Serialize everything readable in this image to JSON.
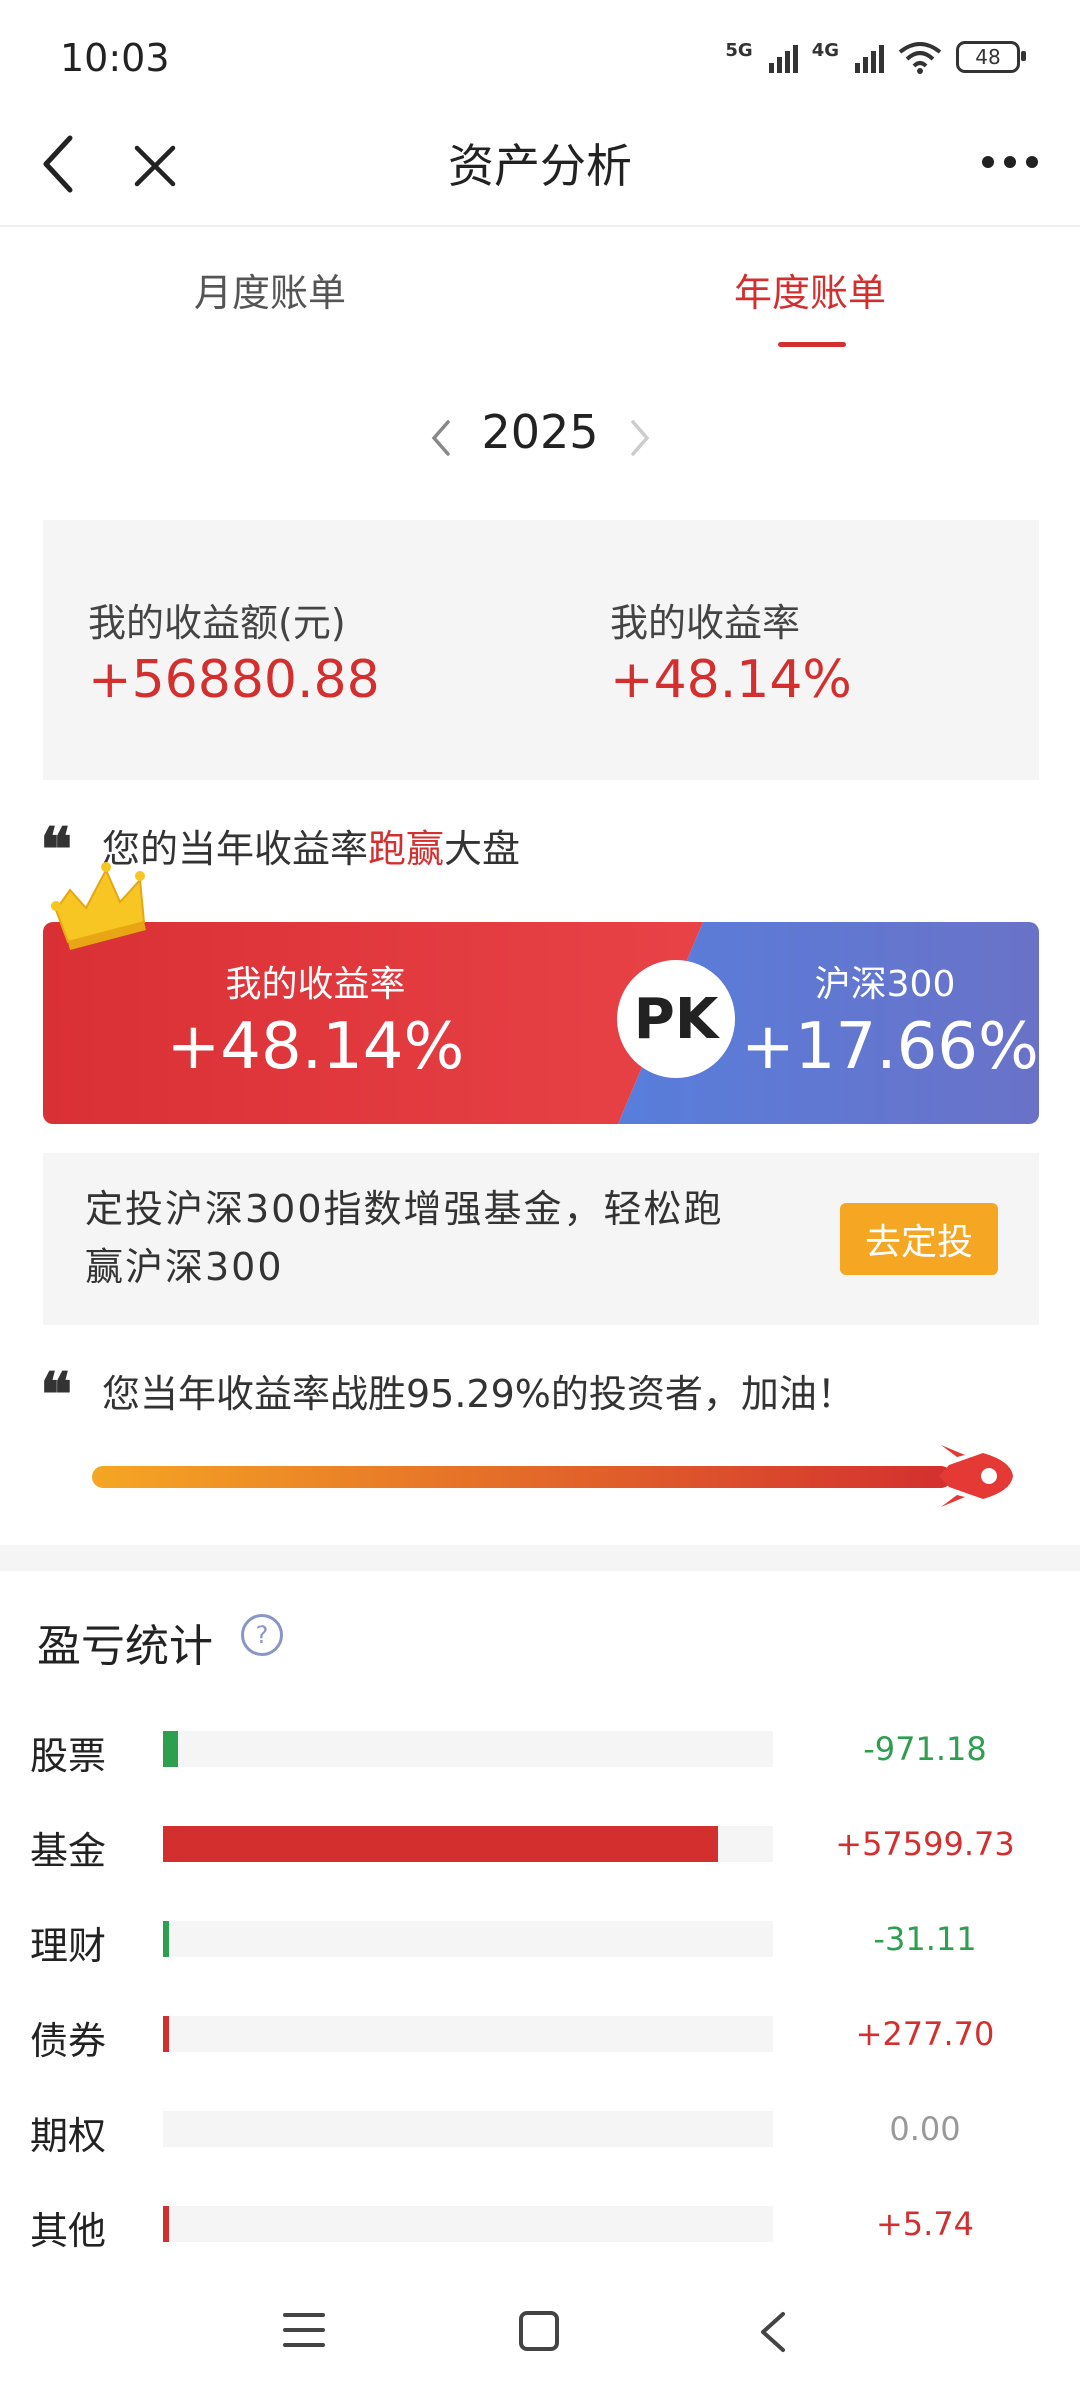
{
  "status_bar": {
    "time": "10:03",
    "net1": "5G",
    "net2": "4G",
    "battery": "48"
  },
  "nav": {
    "title": "资产分析"
  },
  "tabs": [
    {
      "label": "月度账单",
      "active": false
    },
    {
      "label": "年度账单",
      "active": true
    }
  ],
  "year": "2025",
  "summary": {
    "amount_label": "我的收益额(元)",
    "amount_value": "+56880.88",
    "rate_label": "我的收益率",
    "rate_value": "+48.14%"
  },
  "compare": {
    "line_prefix": "您的当年收益率",
    "line_highlight": "跑赢",
    "line_suffix": "大盘",
    "my_label": "我的收益率",
    "my_value": "+48.14%",
    "pk": "PK",
    "index_label": "沪深300",
    "index_value": "+17.66%"
  },
  "promo": {
    "text": "定投沪深300指数增强基金，轻松跑赢沪深300",
    "button": "去定投"
  },
  "rank": {
    "text": "您当年收益率战胜95.29%的投资者，加油！",
    "percent": 95.29
  },
  "stats": {
    "title": "盈亏统计",
    "help": "?",
    "rows": [
      {
        "label": "股票",
        "value": "-971.18",
        "color": "#2e9e4f",
        "fill": 0.025
      },
      {
        "label": "基金",
        "value": "+57599.73",
        "color": "#d32f2f",
        "fill": 0.91
      },
      {
        "label": "理财",
        "value": "-31.11",
        "color": "#2e9e4f",
        "fill": 0.01
      },
      {
        "label": "债券",
        "value": "+277.70",
        "color": "#d32f2f",
        "fill": 0.013
      },
      {
        "label": "期权",
        "value": "0.00",
        "color": "#999999",
        "fill": 0
      },
      {
        "label": "其他",
        "value": "+5.74",
        "color": "#d32f2f",
        "fill": 0.01
      }
    ]
  },
  "colors": {
    "accent": "#d32f2f",
    "gain": "#d32f2f",
    "loss": "#2e9e4f",
    "promo_button": "#f5a623"
  }
}
